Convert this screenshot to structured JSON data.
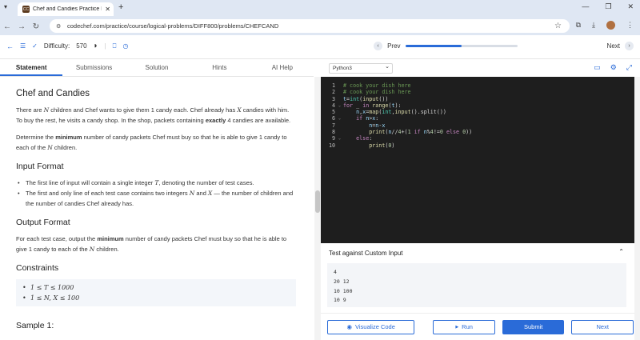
{
  "browser": {
    "tab_title": "Chef and Candies Practice Prob",
    "favicon": "CC",
    "url": "codechef.com/practice/course/logical-problems/DIFF800/problems/CHEFCAND"
  },
  "toolbar": {
    "difficulty_label": "Difficulty:",
    "difficulty_value": "570",
    "prev": "Prev",
    "next": "Next",
    "progress_fraction": 0.5
  },
  "tabs": [
    "Statement",
    "Submissions",
    "Solution",
    "Hints",
    "AI Help"
  ],
  "problem": {
    "title": "Chef and Candies",
    "intro_a": "There are ",
    "N1": "N",
    "intro_b": " children and Chef wants to give them 1 candy each. Chef already has ",
    "X1": "X",
    "intro_c": " candies with him. To buy the rest, he visits a candy shop. In the shop, packets containing ",
    "exactly": "exactly",
    "intro_d": " 4 candies are available.",
    "det_a": "Determine the ",
    "minimum": "minimum",
    "det_b": " number of candy packets Chef must buy so that he is able to give 1 candy to each of the ",
    "N2": "N",
    "det_c": " children.",
    "input_title": "Input Format",
    "in1_a": "The first line of input will contain a single integer ",
    "T": "T",
    "in1_b": ", denoting the number of test cases.",
    "in2_a": "The first and only line of each test case contains two integers ",
    "N3": "N",
    "in2_b": " and ",
    "X2": "X",
    "in2_c": " — the number of children and the number of candies Chef already has.",
    "output_title": "Output Format",
    "out_a": "For each test case, output the ",
    "out_b": " number of candy packets Chef must buy so that he is able to give 1 candy to each of the ",
    "N4": "N",
    "out_c": " children.",
    "constraints_title": "Constraints",
    "c1": "1 ≤ T ≤ 1000",
    "c2": "1 ≤ N, X ≤ 100",
    "sample_title": "Sample 1:"
  },
  "editor": {
    "language": "Python3"
  },
  "test": {
    "title": "Test against Custom Input",
    "input": "4\n20 12\n10 100\n10 9"
  },
  "buttons": {
    "visualize": "Visualize Code",
    "run": "Run",
    "submit": "Submit",
    "next": "Next"
  }
}
